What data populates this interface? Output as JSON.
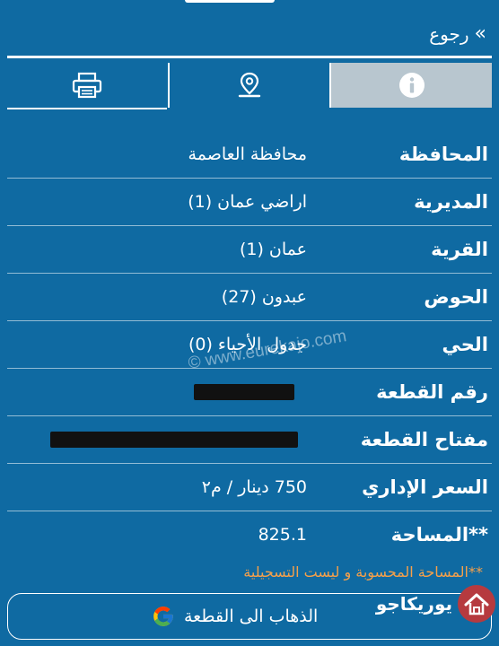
{
  "header": {
    "back_label": "رجوع",
    "back_icon": "double-chevron-icon"
  },
  "tabs": [
    {
      "icon": "printer-icon",
      "active": false
    },
    {
      "icon": "location-pin-icon",
      "active": false
    },
    {
      "icon": "info-icon",
      "active": true
    }
  ],
  "details": [
    {
      "label": "المحافظة",
      "value": "محافظة العاصمة"
    },
    {
      "label": "المديرية",
      "value": "اراضي عمان (1)"
    },
    {
      "label": "القرية",
      "value": "عمان (1)"
    },
    {
      "label": "الحوض",
      "value": "عبدون (27)"
    },
    {
      "label": "الحي",
      "value": "جدول الأحياء (0)"
    },
    {
      "label": "رقم القطعة",
      "value": ""
    },
    {
      "label": "مفتاح القطعة",
      "value": ""
    },
    {
      "label": "السعر الإداري",
      "value": "750 دينار / م٢"
    },
    {
      "label": "**المساحة",
      "value": "825.1"
    }
  ],
  "watermark": "© www.eurekajo.com",
  "note": "**المساحة المحسوبة و ليست التسجيلية",
  "maps_button": {
    "label": "الذهاب الى القطعة",
    "icon": "google-icon"
  },
  "logo": {
    "text": "يوريكاجو"
  },
  "colors": {
    "background": "#0f6aa2",
    "active_tab": "#b8c6cf",
    "note": "#f6a04a",
    "logo": "#b63a3f"
  }
}
